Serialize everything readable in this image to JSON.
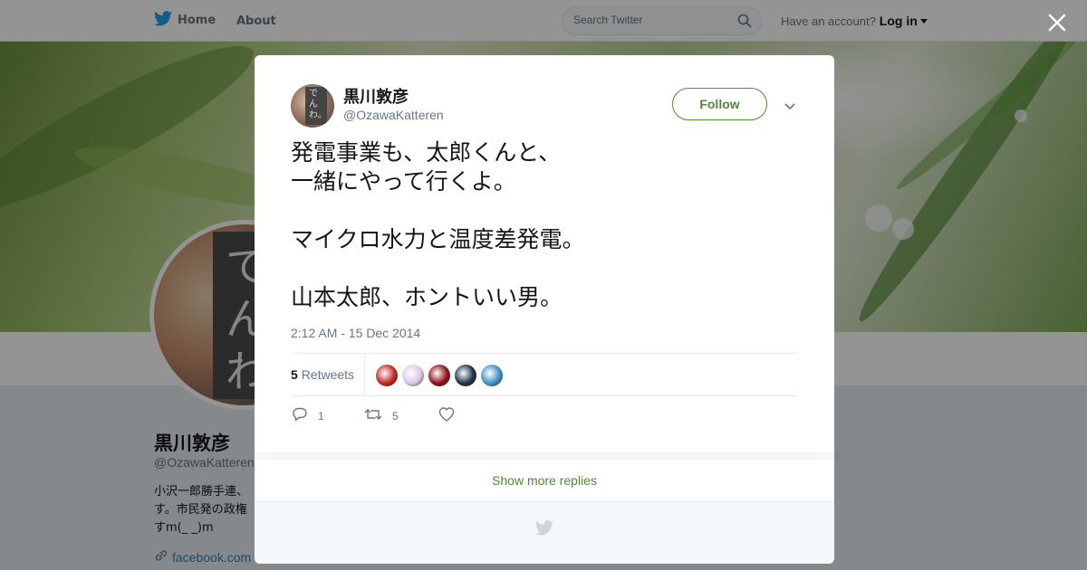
{
  "nav": {
    "home_label": "Home",
    "about_label": "About",
    "search_placeholder": "Search Twitter",
    "account_prompt": "Have an account?",
    "login_label": "Log in"
  },
  "profile": {
    "name": "黒川敦彦",
    "handle": "@OzawaKatteren",
    "bio_lines": [
      "小沢一郎勝手連、",
      "す。市民発の政権",
      "すm(_ _)m"
    ],
    "link_text": "facebook.com",
    "avatar_text": "でんわ"
  },
  "tweet": {
    "author_name": "黒川敦彦",
    "author_handle": "@OzawaKatteren",
    "avatar_text": "でんわ。",
    "follow_label": "Follow",
    "text": "発電事業も、太郎くんと、\n一緒にやって行くよ。\n\nマイクロ水力と温度差発電。\n\n山本太郎、ホントいい男。",
    "timestamp": "2:12 AM - 15 Dec 2014",
    "retweet_count": "5",
    "retweet_label": "Retweets",
    "retweeter_avatars": [
      {
        "name": "retweeter-1",
        "color": "#c0281f"
      },
      {
        "name": "retweeter-2",
        "color": "#d9c8e4"
      },
      {
        "name": "retweeter-3",
        "color": "#8f1016"
      },
      {
        "name": "retweeter-4",
        "color": "#1e3346"
      },
      {
        "name": "retweeter-5",
        "color": "#3f8fc2"
      }
    ],
    "reply_count": "1",
    "retweet_action_count": "5"
  },
  "replies": {
    "show_more_label": "Show more replies"
  },
  "colors": {
    "accent": "#4f8a2d",
    "twitter_blue": "#1da1f2"
  }
}
